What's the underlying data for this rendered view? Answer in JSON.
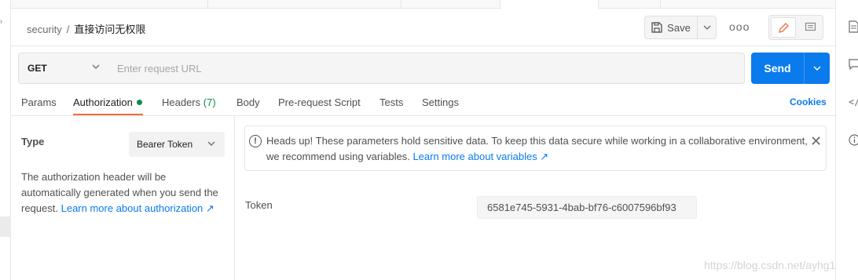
{
  "breadcrumb": {
    "collection": "security",
    "separator": "/",
    "request": "直接访问无权限"
  },
  "toolbar": {
    "save_label": "Save",
    "more_label": "ooo"
  },
  "request": {
    "method": "GET",
    "url_placeholder": "Enter request URL",
    "send_label": "Send"
  },
  "tabs": {
    "params": "Params",
    "authorization": "Authorization",
    "headers": "Headers",
    "headers_count": "(7)",
    "body": "Body",
    "prerequest": "Pre-request Script",
    "tests": "Tests",
    "settings": "Settings",
    "cookies": "Cookies"
  },
  "auth": {
    "type_label": "Type",
    "type_value": "Bearer Token",
    "description": "The authorization header will be automatically generated when you send the request.",
    "learn_more": "Learn more about authorization ↗"
  },
  "alert": {
    "text": "Heads up! These parameters hold sensitive data. To keep this data secure while working in a collaborative environment, we recommend using variables.",
    "link": "Learn more about variables ↗"
  },
  "token": {
    "label": "Token",
    "value": "6581e745-5931-4bab-bf76-c6007596bf93"
  },
  "watermark": "https://blog.csdn.net/ayhg1",
  "colors": {
    "accent": "#f26b3a",
    "send": "#097bed",
    "status_dot": "#0b8d4e"
  }
}
